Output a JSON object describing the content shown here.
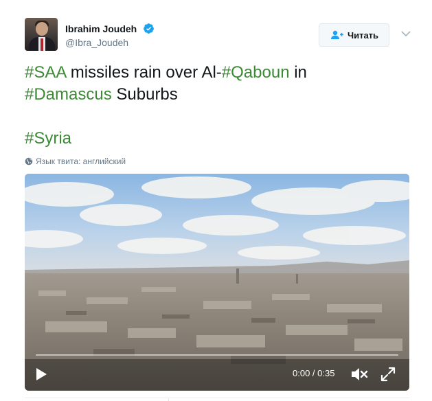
{
  "tweet": {
    "author": {
      "name": "Ibrahim Joudeh",
      "handle": "@Ibra_Joudeh",
      "verified": true
    },
    "follow_label": "Читать",
    "text": {
      "line1": [
        {
          "type": "hashtag",
          "value": "#SAA"
        },
        {
          "type": "text",
          "value": " missiles rain over Al-"
        },
        {
          "type": "hashtag",
          "value": "#Qaboun"
        },
        {
          "type": "text",
          "value": " in"
        }
      ],
      "line2": [
        {
          "type": "hashtag",
          "value": "#Damascus"
        },
        {
          "type": "text",
          "value": " Suburbs"
        }
      ],
      "line3": [
        {
          "type": "hashtag",
          "value": "#Syria"
        }
      ]
    },
    "language_note": "Язык твита: английский",
    "video": {
      "time_display": "0:00 / 0:35",
      "progress": 0.0,
      "icons": {
        "play": "play-icon",
        "mute": "mute-icon",
        "fullscreen": "fullscreen-icon"
      }
    }
  },
  "colors": {
    "hashtag": "#3b8b35",
    "verified": "#1da1f2",
    "secondary_text": "#657786"
  }
}
